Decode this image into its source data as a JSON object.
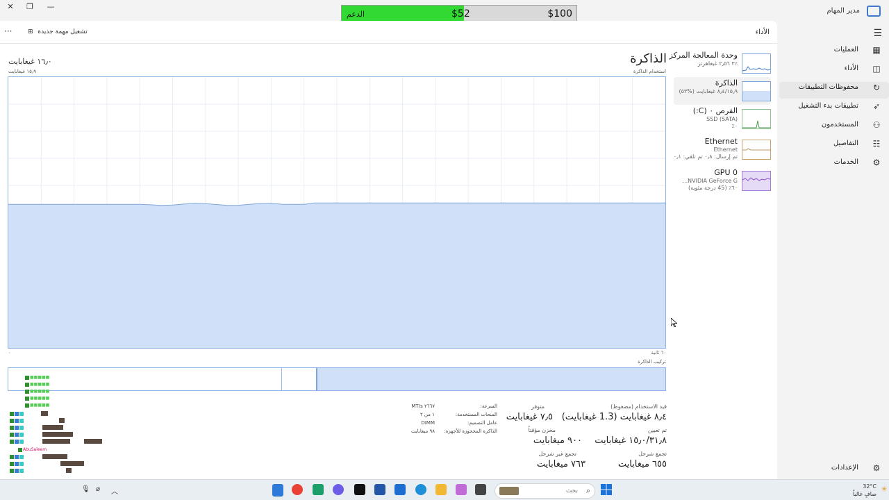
{
  "window": {
    "title": "مدير المهام"
  },
  "donation": {
    "support_label": "الدعم",
    "current": "$52",
    "goal": "$100",
    "progress": 0.52,
    "fill_color": "#33d933"
  },
  "header": {
    "section_title": "الأداء",
    "run_new_task": "تشغيل مهمة جديدة",
    "more": "···"
  },
  "nav": {
    "items": [
      {
        "label": "العمليات",
        "icon": "processes-icon"
      },
      {
        "label": "الأداء",
        "icon": "performance-icon"
      },
      {
        "label": "محفوظات التطبيقات",
        "icon": "app-history-icon"
      },
      {
        "label": "تطبيقات بدء التشغيل",
        "icon": "startup-apps-icon"
      },
      {
        "label": "المستخدمون",
        "icon": "users-icon"
      },
      {
        "label": "التفاصيل",
        "icon": "details-icon"
      },
      {
        "label": "الخدمات",
        "icon": "services-icon"
      }
    ],
    "settings": "الإعدادات"
  },
  "perf": {
    "cards": [
      {
        "title": "وحدة المعالجة المركز",
        "line2": "٪٣ ٢٫٥٦ غيغاهرتز",
        "line3": ""
      },
      {
        "title": "الذاكرة",
        "line2": "٨٫٤/١٥٫٩ غيغابايت (%٥٣)",
        "line3": ""
      },
      {
        "title": "القرص ٠ (C:)",
        "line2": "SSD (SATA)",
        "line3": "٠٪"
      },
      {
        "title": "Ethernet",
        "line2": "Ethernet",
        "line3": "تم إرسال: ٠٫٨ تم تلقي: ٠٫١"
      },
      {
        "title": "GPU 0",
        "line2": "NVIDIA GeForce G...",
        "line3": "٦٠٪ (45 درجة مئوية)"
      }
    ]
  },
  "memory": {
    "title": "الذاكرة",
    "total": "١٦٫٠ غيغابايت",
    "usage_label": "استخدام الذاكرة",
    "max_label": "١٥٫٩ غيغابايت",
    "time_label": "٦٠ ثانية",
    "zero_label": "٠",
    "composition_label": "تركيب الذاكرة",
    "usage_fraction": 0.53,
    "fill_color": "#cfe0f8",
    "line_color": "#7ea6d8"
  },
  "stats": {
    "in_use_label": "قيد الاستخدام (مضغوط)",
    "in_use": "٨٫٤ غيغابايت (1.3 غيغابايت)",
    "available_label": "متوفر",
    "available": "٧٫٥ غيغابايت",
    "committed_label": "تم تعيين",
    "committed": "١٥٫٠/٣١٫٨ غيغابايت",
    "cached_label": "مخزن مؤقتاً",
    "cached": "٩٠٠ ميغابايت",
    "paged_label": "تجمع شرحل",
    "paged": "٦٥٥ ميغابايت",
    "nonpaged_label": "تجمع غير شرحل",
    "nonpaged": "٧٦٣ ميغابايت"
  },
  "info": {
    "speed_label": "السرعة:",
    "speed": "٢٦٦٧ MT/s",
    "slots_label": "المنحات المستخدمة:",
    "slots": "١ من ٢",
    "form_label": "عامل التصميم:",
    "form": "DIMM",
    "reserved_label": "الذاكرة المحجوزة للأجهزة:",
    "reserved": "٩٨ ميغابايت"
  },
  "chat": {
    "highlight_user": "AbuSaleem"
  },
  "taskbar": {
    "search_placeholder": "بحث",
    "weather_temp": "32°C",
    "weather_desc": "صافٍ غالباً"
  }
}
